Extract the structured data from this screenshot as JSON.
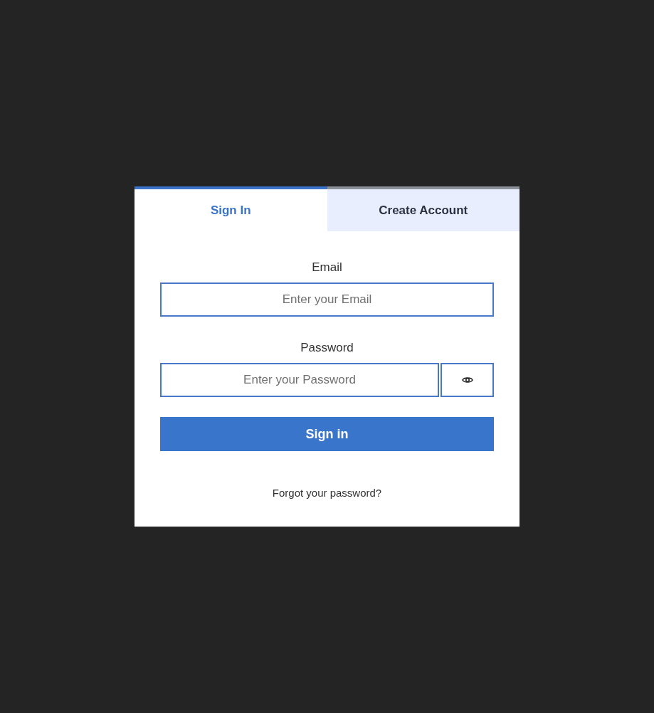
{
  "tabs": [
    {
      "label": "Sign In",
      "selected": true
    },
    {
      "label": "Create Account",
      "selected": false
    }
  ],
  "fields": [
    {
      "label": "Email",
      "placeholder": "Enter your Email",
      "kind": "text"
    },
    {
      "label": "Password",
      "placeholder": "Enter your Password",
      "kind": "password"
    }
  ],
  "submit_button": "Sign in",
  "forgot_link": "Forgot your password?"
}
